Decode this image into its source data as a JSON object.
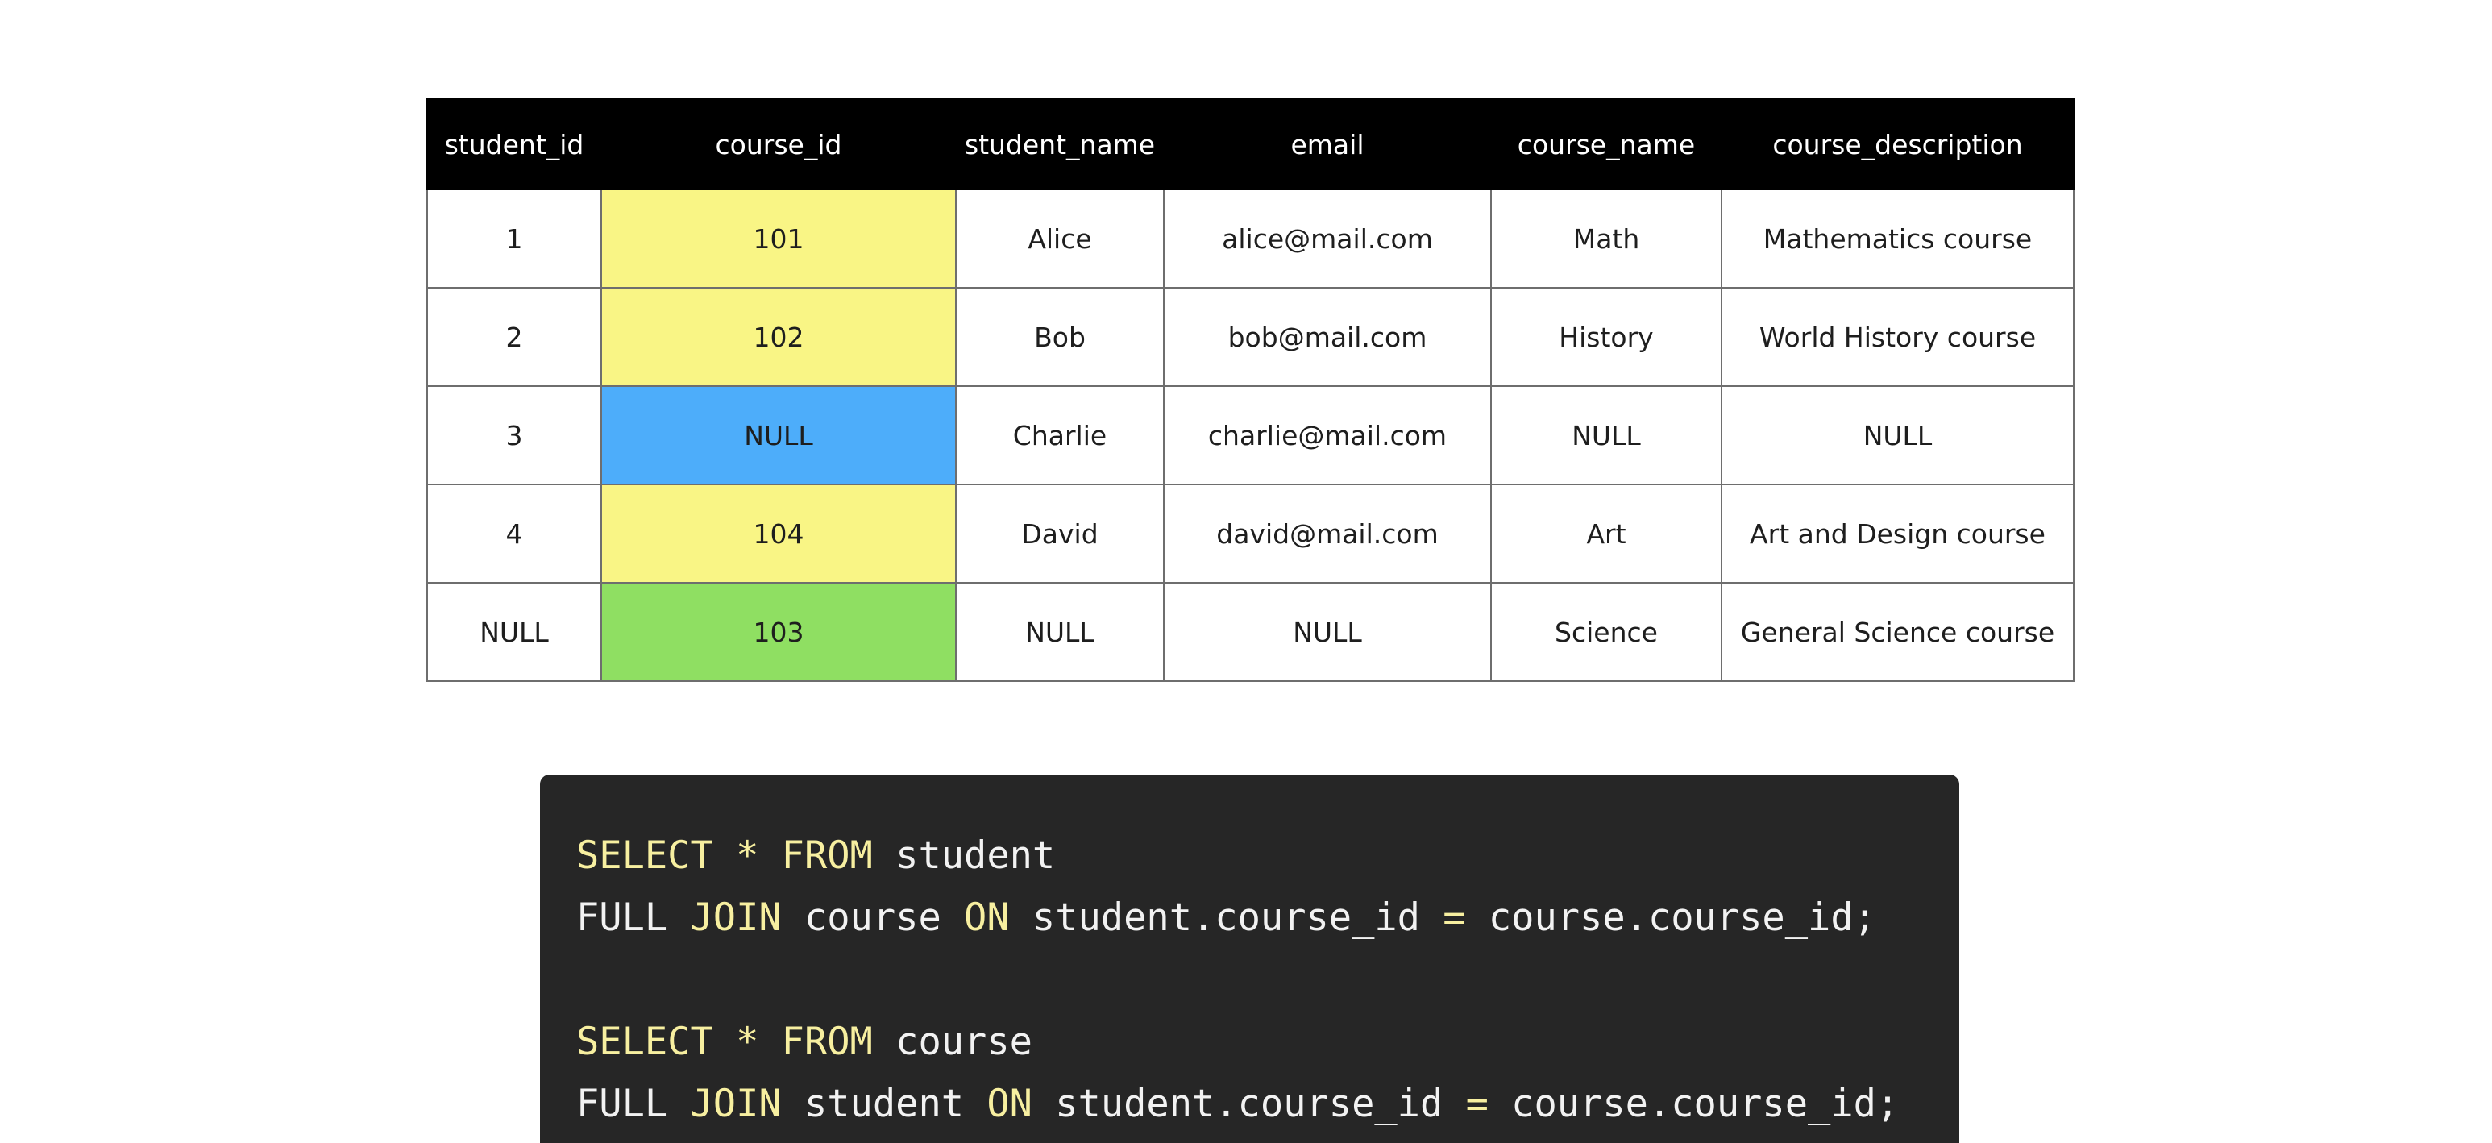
{
  "table": {
    "headers": [
      "student_id",
      "course_id",
      "student_name",
      "email",
      "course_name",
      "course_description"
    ],
    "column_highlight": {
      "column": "course_id",
      "colors": [
        "#f9f585",
        "#f9f585",
        "#4dadfa",
        "#f9f585",
        "#8fdf62"
      ]
    },
    "rows": [
      [
        "1",
        "101",
        "Alice",
        "alice@mail.com",
        "Math",
        "Mathematics course"
      ],
      [
        "2",
        "102",
        "Bob",
        "bob@mail.com",
        "History",
        "World History course"
      ],
      [
        "3",
        "NULL",
        "Charlie",
        "charlie@mail.com",
        "NULL",
        "NULL"
      ],
      [
        "4",
        "104",
        "David",
        "david@mail.com",
        "Art",
        "Art and Design course"
      ],
      [
        "NULL",
        "103",
        "NULL",
        "NULL",
        "Science",
        "General Science course"
      ]
    ]
  },
  "code": {
    "keyword_color": "#f7efa0",
    "text_color": "#f2f2f2",
    "lines": [
      [
        {
          "t": "SELECT",
          "kw": true
        },
        {
          "t": " "
        },
        {
          "t": "*",
          "kw": true
        },
        {
          "t": " "
        },
        {
          "t": "FROM",
          "kw": true
        },
        {
          "t": " student"
        }
      ],
      [
        {
          "t": "FULL "
        },
        {
          "t": "JOIN",
          "kw": true
        },
        {
          "t": " course "
        },
        {
          "t": "ON",
          "kw": true
        },
        {
          "t": " student.course_id "
        },
        {
          "t": "=",
          "kw": true
        },
        {
          "t": " course.course_id;"
        }
      ],
      [],
      [
        {
          "t": "SELECT",
          "kw": true
        },
        {
          "t": " "
        },
        {
          "t": "*",
          "kw": true
        },
        {
          "t": " "
        },
        {
          "t": "FROM",
          "kw": true
        },
        {
          "t": " course"
        }
      ],
      [
        {
          "t": "FULL "
        },
        {
          "t": "JOIN",
          "kw": true
        },
        {
          "t": " student "
        },
        {
          "t": "ON",
          "kw": true
        },
        {
          "t": " student.course_id "
        },
        {
          "t": "=",
          "kw": true
        },
        {
          "t": " course.course_id;"
        }
      ]
    ]
  }
}
